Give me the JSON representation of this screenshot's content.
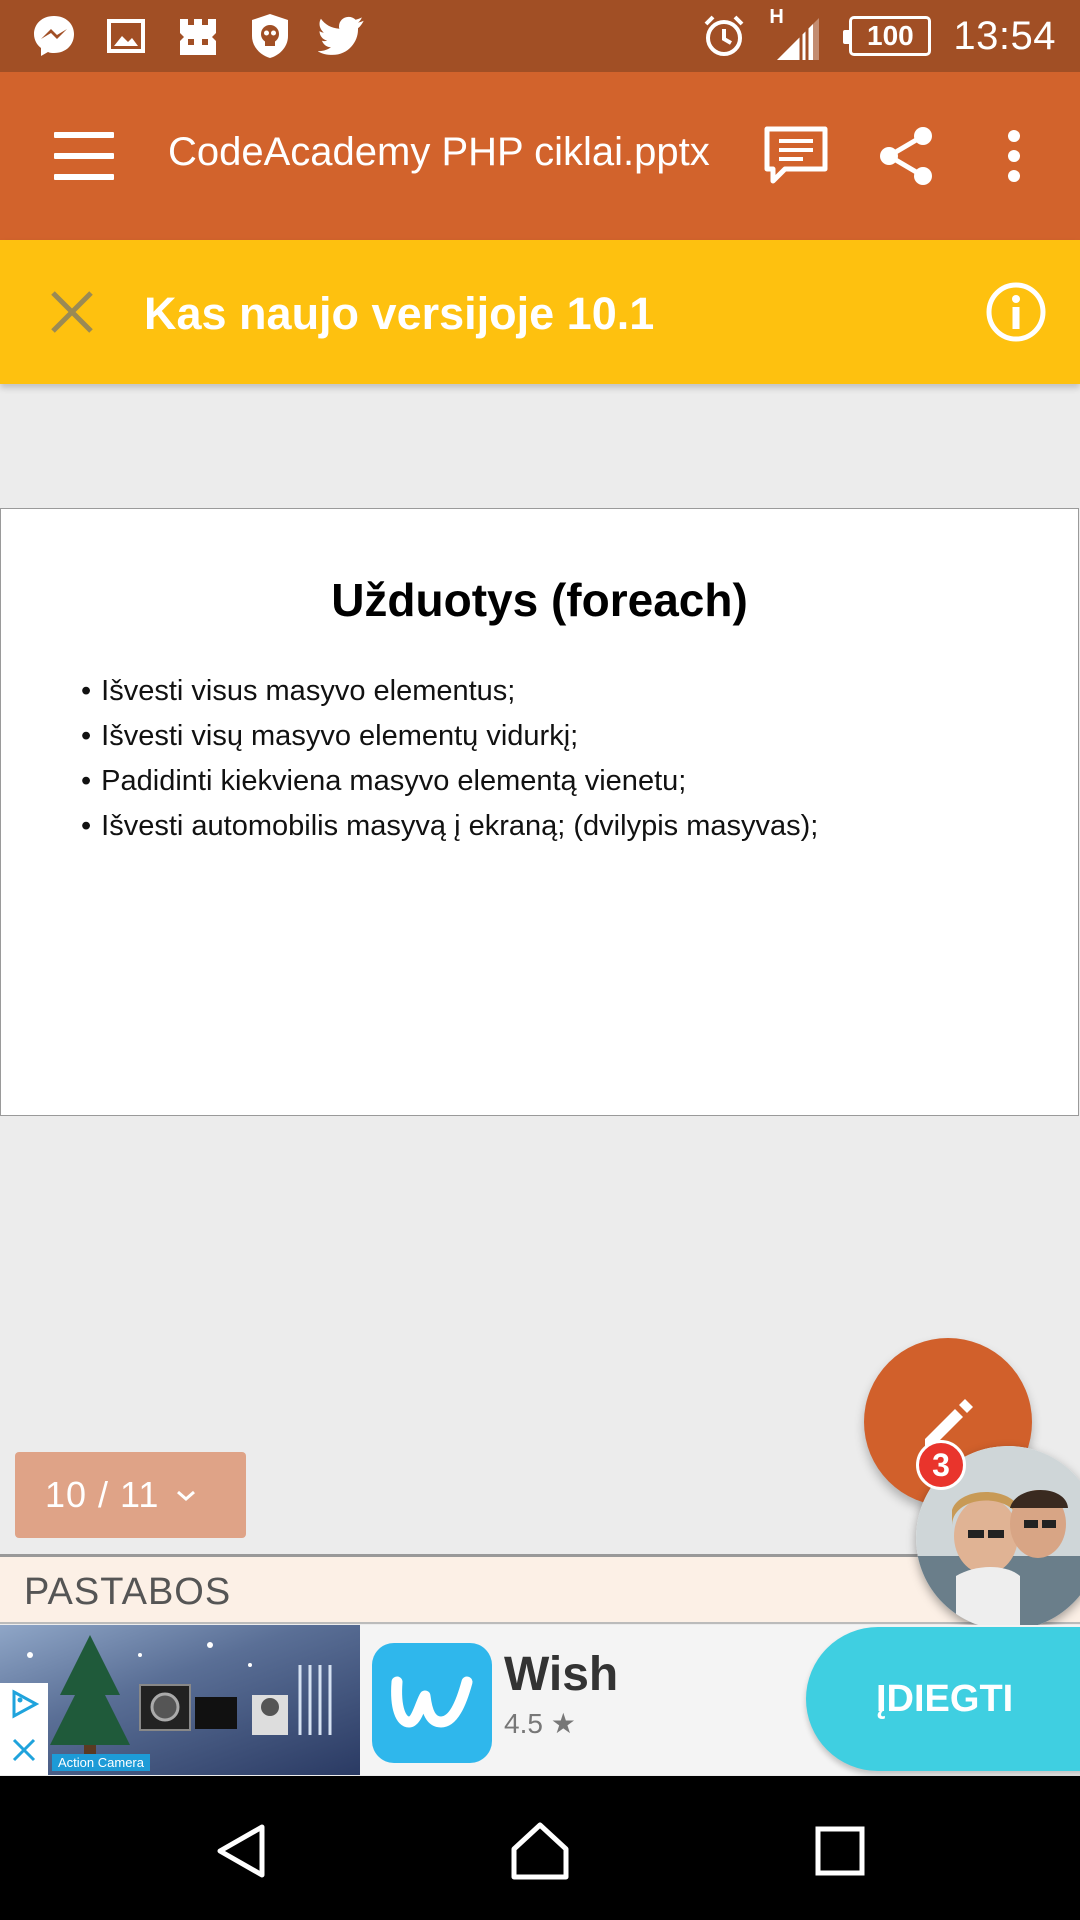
{
  "status_bar": {
    "notification_icons": [
      "messenger-icon",
      "gallery-icon",
      "game-icon",
      "shield-skull-icon",
      "twitter-icon"
    ],
    "network_type": "H",
    "battery": "100",
    "time": "13:54"
  },
  "app_bar": {
    "title": "CodeAcademy PHP ciklai.pptx",
    "icons": [
      "menu-icon",
      "comments-icon",
      "share-icon",
      "more-vert-icon"
    ]
  },
  "banner": {
    "text": "Kas naujo versijoje 10.1"
  },
  "slide": {
    "title": "Užduotys (foreach)",
    "bullets": [
      "Išvesti visus masyvo elementus;",
      "Išvesti visų masyvo elementų vidurkį;",
      "Padidinti kiekviena masyvo elementą vienetu;",
      "Išvesti automobilis masyvą į ekraną; (dvilypis masyvas);"
    ]
  },
  "pager": {
    "label": "10 / 11"
  },
  "notes": {
    "label": "PASTABOS"
  },
  "chat_head": {
    "badge": "3"
  },
  "ad": {
    "image_caption": "Action Camera",
    "app_name": "Wish",
    "rating": "4.5",
    "install_label": "ĮDIEGTI"
  },
  "colors": {
    "status_bar": "#a14f25",
    "app_bar": "#d2632c",
    "banner": "#fec10f",
    "fab": "#d1602b",
    "install": "#3fcfe1"
  }
}
